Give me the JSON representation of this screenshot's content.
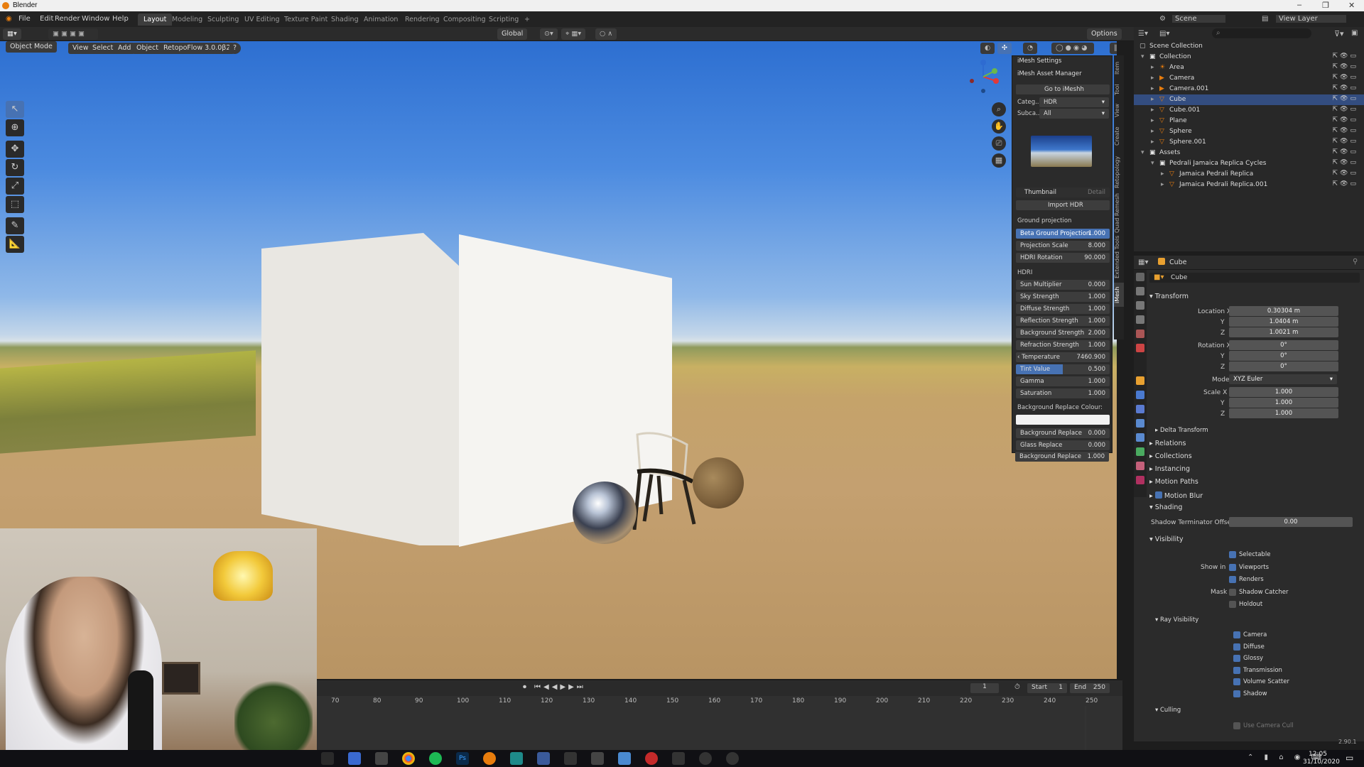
{
  "window": {
    "title": "Blender",
    "controls": [
      "–",
      "❐",
      "✕"
    ]
  },
  "menu": [
    "File",
    "Edit",
    "Render",
    "Window",
    "Help"
  ],
  "workspaces": [
    "Layout",
    "Modeling",
    "Sculpting",
    "UV Editing",
    "Texture Paint",
    "Shading",
    "Animation",
    "Rendering",
    "Compositing",
    "Scripting",
    "+"
  ],
  "scene": {
    "name": "Scene",
    "view_layer": "View Layer"
  },
  "header": {
    "mode": "Object Mode",
    "view": "View",
    "select": "Select",
    "add": "Add",
    "object": "Object",
    "addon": "RetopoFlow 3.0.0β2",
    "orientation": "Global",
    "options": "Options"
  },
  "imesh": {
    "settings": "iMesh Settings",
    "asset_manager": "iMesh Asset Manager",
    "go_to": "Go to iMeshh",
    "category_label": "Categ..",
    "category_value": "HDR",
    "subcat_label": "Subca..",
    "subcat_value": "All",
    "thumbnail": "Thumbnail",
    "detail": "Detail",
    "import": "Import HDR",
    "ground_projection": "Ground projection",
    "ground_rows": [
      {
        "label": "Beta Ground Projection",
        "value": "1.000"
      },
      {
        "label": "Projection Scale",
        "value": "8.000"
      },
      {
        "label": "HDRI Rotation",
        "value": "90.000"
      }
    ],
    "hdri_label": "HDRI",
    "hdri_rows": [
      {
        "label": "Sun Multiplier",
        "value": "0.000"
      },
      {
        "label": "Sky Strength",
        "value": "1.000"
      },
      {
        "label": "Diffuse Strength",
        "value": "1.000"
      },
      {
        "label": "Reflection Strength",
        "value": "1.000"
      },
      {
        "label": "Background Strength",
        "value": "2.000"
      },
      {
        "label": "Refraction Strength",
        "value": "1.000"
      },
      {
        "label": "Temperature",
        "value": "7460.900"
      },
      {
        "label": "Tint Value",
        "value": "0.500"
      },
      {
        "label": "Gamma",
        "value": "1.000"
      },
      {
        "label": "Saturation",
        "value": "1.000"
      }
    ],
    "bg_replace_colour": "Background Replace Colour:",
    "bg_rows": [
      {
        "label": "Background Replace",
        "value": "0.000"
      },
      {
        "label": "Glass Replace",
        "value": "0.000"
      },
      {
        "label": "Background Replace",
        "value": "1.000"
      }
    ]
  },
  "side_tabs": [
    "Item",
    "Tool",
    "View",
    "Create",
    "Retopology",
    "Quad Remesh",
    "Extended Tools",
    "iMesh"
  ],
  "outliner": {
    "root": "Scene Collection",
    "rows": [
      {
        "label": "Collection",
        "indent": 1,
        "icon": "collection"
      },
      {
        "label": "Area",
        "indent": 2,
        "icon": "light"
      },
      {
        "label": "Camera",
        "indent": 2,
        "icon": "camera"
      },
      {
        "label": "Camera.001",
        "indent": 2,
        "icon": "camera"
      },
      {
        "label": "Cube",
        "indent": 2,
        "icon": "mesh",
        "selected": true
      },
      {
        "label": "Cube.001",
        "indent": 2,
        "icon": "mesh"
      },
      {
        "label": "Plane",
        "indent": 2,
        "icon": "mesh"
      },
      {
        "label": "Sphere",
        "indent": 2,
        "icon": "mesh"
      },
      {
        "label": "Sphere.001",
        "indent": 2,
        "icon": "mesh"
      },
      {
        "label": "Assets",
        "indent": 1,
        "icon": "collection"
      },
      {
        "label": "Pedrali Jamaica Replica Cycles",
        "indent": 2,
        "icon": "collection"
      },
      {
        "label": "Jamaica Pedrali Replica",
        "indent": 3,
        "icon": "mesh"
      },
      {
        "label": "Jamaica Pedrali Replica.001",
        "indent": 3,
        "icon": "mesh"
      }
    ]
  },
  "properties": {
    "object_name": "Cube",
    "object_field": "Cube",
    "transform": "Transform",
    "location_label": "Location X",
    "location": [
      "0.30304 m",
      "1.0404 m",
      "1.0021 m"
    ],
    "rotation_label": "Rotation X",
    "rotation": [
      "0°",
      "0°",
      "0°"
    ],
    "mode_label": "Mode",
    "mode_value": "XYZ Euler",
    "scale_label": "Scale X",
    "scale": [
      "1.000",
      "1.000",
      "1.000"
    ],
    "axis_y": "Y",
    "axis_z": "Z",
    "delta": "Delta Transform",
    "sections": [
      "Relations",
      "Collections",
      "Instancing",
      "Motion Paths",
      "Motion Blur"
    ],
    "shading": "Shading",
    "shadow_term_label": "Shadow Terminator Offset",
    "shadow_term_value": "0.00",
    "visibility": "Visibility",
    "selectable": "Selectable",
    "show_in": "Show in",
    "viewports": "Viewports",
    "renders": "Renders",
    "mask": "Mask",
    "shadow_catcher": "Shadow Catcher",
    "holdout": "Holdout",
    "ray_visibility": "Ray Visibility",
    "rays": [
      "Camera",
      "Diffuse",
      "Glossy",
      "Transmission",
      "Volume Scatter",
      "Shadow"
    ],
    "culling": "Culling",
    "use_camera_cull": "Use Camera Cull",
    "version": "2.90.1"
  },
  "timeline": {
    "current_frame": "1",
    "start_label": "Start",
    "start": "1",
    "end_label": "End",
    "end": "250",
    "ticks": [
      "70",
      "80",
      "90",
      "100",
      "110",
      "120",
      "130",
      "140",
      "150",
      "160",
      "170",
      "180",
      "190",
      "200",
      "210",
      "220",
      "230",
      "240",
      "250"
    ]
  },
  "taskbar": {
    "time": "12:05",
    "date": "31/10/2020"
  },
  "colors": {
    "accent": "#4772b3",
    "selection": "#334d80",
    "panel": "#2b2b2b",
    "viewport_sky": "#4c8be0"
  }
}
